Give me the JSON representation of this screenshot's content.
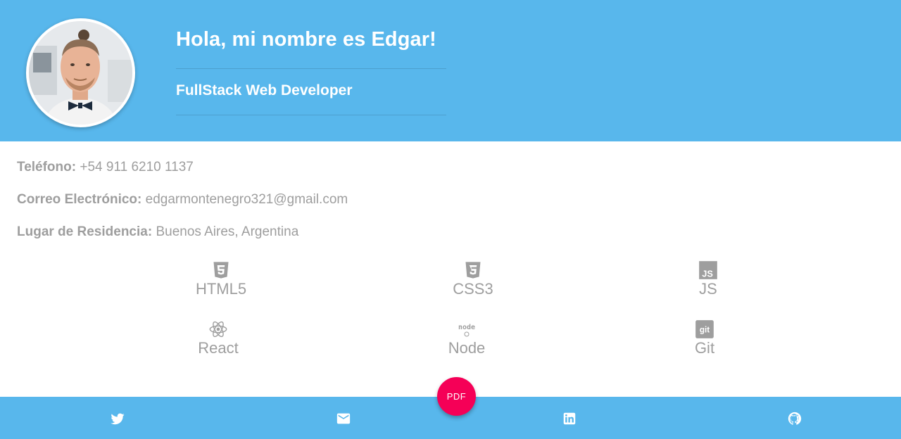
{
  "header": {
    "greeting": "Hola, mi nombre es Edgar!",
    "role": "FullStack Web Developer"
  },
  "contact": [
    {
      "label": "Teléfono:",
      "value": "+54 911 6210 1137"
    },
    {
      "label": "Correo Electrónico:",
      "value": "edgarmontenegro321@gmail.com"
    },
    {
      "label": "Lugar de Residencia:",
      "value": "Buenos Aires, Argentina"
    }
  ],
  "skills": [
    {
      "name": "HTML5",
      "icon": "html5-icon"
    },
    {
      "name": "CSS3",
      "icon": "css3-icon"
    },
    {
      "name": "JS",
      "icon": "js-icon"
    },
    {
      "name": "React",
      "icon": "react-icon"
    },
    {
      "name": "Node",
      "icon": "node-icon"
    },
    {
      "name": "Git",
      "icon": "git-icon"
    }
  ],
  "footer": {
    "pdf_label": "PDF",
    "icons": [
      "twitter-icon",
      "mail-icon",
      "linkedin-icon",
      "github-icon"
    ]
  },
  "colors": {
    "primary": "#58b7ec",
    "accent": "#f50057",
    "muted_text": "#9e9e9e"
  }
}
